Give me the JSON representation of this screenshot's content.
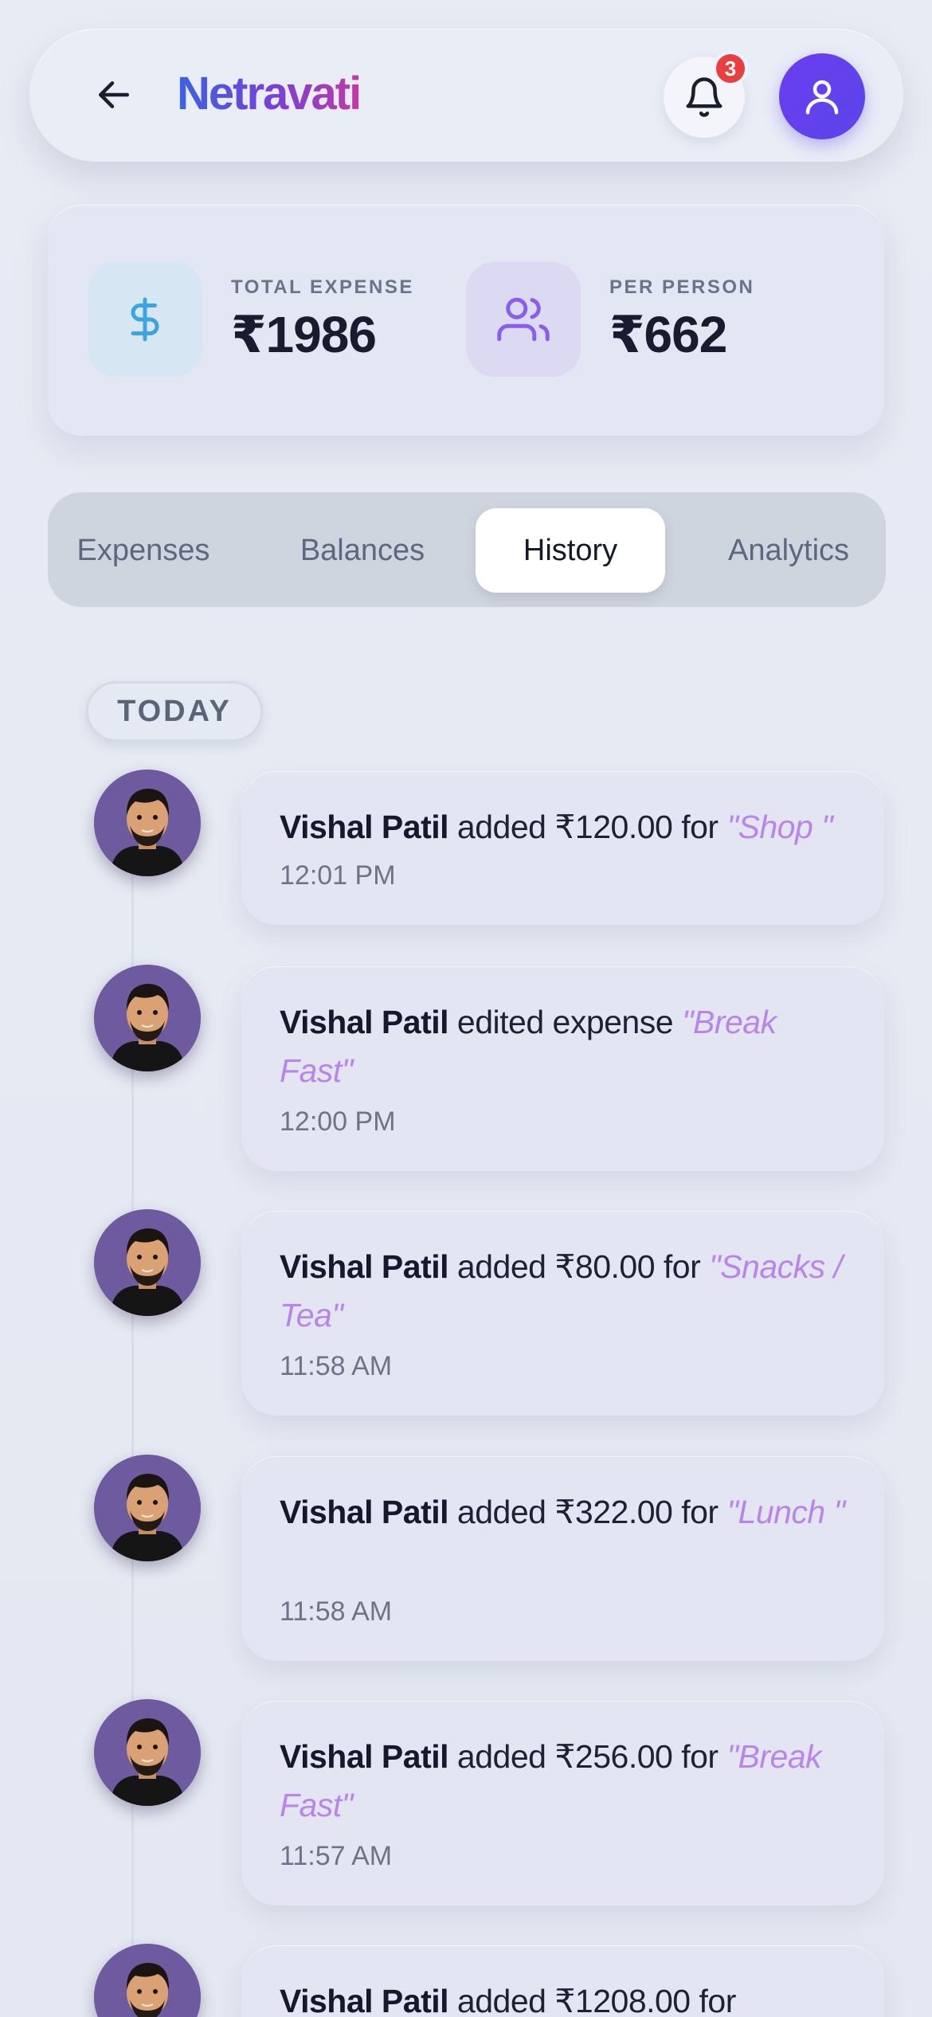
{
  "header": {
    "title": "Netravati",
    "notification_count": "3"
  },
  "stats": {
    "total_label": "TOTAL EXPENSE",
    "total_value": "₹1986",
    "per_person_label": "PER PERSON",
    "per_person_value": "₹662"
  },
  "tabs": [
    {
      "label": "Expenses",
      "active": false
    },
    {
      "label": "Balances",
      "active": false
    },
    {
      "label": "History",
      "active": true
    },
    {
      "label": "Analytics",
      "active": false
    }
  ],
  "history": {
    "day_label": "TODAY",
    "entries": [
      {
        "user": "Vishal Patil",
        "action": "added ₹120.00 for",
        "item": "\"Shop \"",
        "time": "12:01 PM"
      },
      {
        "user": "Vishal Patil",
        "action": "edited expense",
        "item": "\"Break Fast\"",
        "time": "12:00 PM"
      },
      {
        "user": "Vishal Patil",
        "action": "added ₹80.00 for",
        "item": "\"Snacks / Tea\"",
        "time": "11:58 AM"
      },
      {
        "user": "Vishal Patil",
        "action": "added ₹322.00 for",
        "item": "\"Lunch \"",
        "time": "11:58 AM"
      },
      {
        "user": "Vishal Patil",
        "action": "added ₹256.00 for",
        "item": "\"Break Fast\"",
        "time": "11:57 AM"
      },
      {
        "user": "Vishal Patil",
        "action": "added ₹1208.00 for",
        "item": "",
        "time": ""
      }
    ]
  },
  "colors": {
    "accent": "#5b45e8",
    "badge": "#ea3f3f",
    "item_text": "#b985ea"
  }
}
